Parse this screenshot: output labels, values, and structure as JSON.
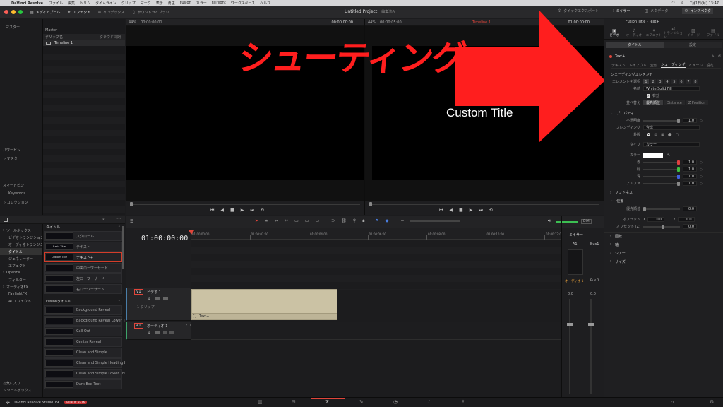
{
  "menubar": {
    "app": "DaVinci Resolve",
    "items": [
      "ファイル",
      "編集",
      "トリム",
      "タイムライン",
      "クリップ",
      "マーク",
      "表示",
      "再生",
      "Fusion",
      "カラー",
      "Fairlight",
      "ワークスペース",
      "ヘルプ"
    ],
    "clock": "7月1日(月) 13:47"
  },
  "titlebar": {
    "media_pool": "メディアプール",
    "effects": "エフェクト",
    "index": "インデックス",
    "sound_library": "サウンドライブラリ",
    "project": "Untitled Project",
    "edited": "編集済み",
    "quick_export": "クイックエクスポート",
    "mixer": "ミキサー",
    "metadata": "メタデータ",
    "inspector": "インスペクタ"
  },
  "media": {
    "master": "マスター",
    "master2": "Master",
    "col_clip": "クリップ名",
    "col_cloud": "クラウド同期",
    "timeline": "Timeline 1",
    "power_bins": "パワービン",
    "power_master": "マスター",
    "smart_bins": "スマートビン",
    "keywords": "Keywords",
    "collections": "コレクション"
  },
  "source_viewer": {
    "zoom": "44%",
    "timecode": "00:00:00:01",
    "tc_right": "00:00:00:00"
  },
  "timeline_viewer": {
    "zoom": "44%",
    "timecode": "00:00:05:00",
    "name": "Timeline 1",
    "tc_right": "01:00:00:00"
  },
  "overlay": {
    "heading": "シューティング",
    "custom_title": "Custom Title"
  },
  "effects": {
    "tree": [
      {
        "label": "ツールボックス",
        "indent": 0
      },
      {
        "label": "ビデオトランジション",
        "indent": 1
      },
      {
        "label": "オーディオトランジション",
        "indent": 1
      },
      {
        "label": "タイトル",
        "indent": 1,
        "selected": true
      },
      {
        "label": "ジェネレーター",
        "indent": 1
      },
      {
        "label": "エフェクト",
        "indent": 1
      },
      {
        "label": "OpenFX",
        "indent": 0
      },
      {
        "label": "フィルター",
        "indent": 1
      },
      {
        "label": "オーディオFX",
        "indent": 0
      },
      {
        "label": "FairlightFX",
        "indent": 1
      },
      {
        "label": "AUエフェクト",
        "indent": 1
      }
    ],
    "fav": "お気に入り",
    "fav_toolbox": "ツールボックス",
    "titles_header": "タイトル",
    "titles": [
      {
        "label": "スクロール",
        "thumb": ""
      },
      {
        "label": "テキスト",
        "thumb": "Basic Title"
      },
      {
        "label": "テキスト+",
        "thumb": "Custom Title",
        "selected": true
      },
      {
        "label": "中央ローワーサード",
        "thumb": ""
      },
      {
        "label": "左ローワーサード",
        "thumb": ""
      },
      {
        "label": "右ローワーサード",
        "thumb": ""
      }
    ],
    "fusion_header": "Fusionタイトル",
    "fusion": [
      "Background Reveal",
      "Background Reveal Lower Third",
      "Call Out",
      "Center Reveal",
      "Clean and Simple",
      "Clean and Simple Heading Low...",
      "Clean and Simple Lower Third",
      "Dark Box Text"
    ]
  },
  "timeline": {
    "timecode": "01:00:00:00",
    "ruler": [
      "01:00:00:00",
      "01:00:02:00",
      "01:00:04:00",
      "01:00:06:00",
      "01:00:08:00",
      "01:00:10:00",
      "01:00:12:00"
    ],
    "v1": "V1",
    "v1_name": "ビデオ 1",
    "v1_clips": "1 クリップ",
    "a1": "A1",
    "a1_name": "オーディオ 1",
    "a1_ch": "2.0",
    "clip": "Text+",
    "dim": "DIM"
  },
  "mixer": {
    "title": "ミキサー",
    "a1": "A1",
    "bus1": "Bus1",
    "audio1": "オーディオ 1",
    "bus1b": "Bus 1",
    "db1": "0.0",
    "db2": "0.0"
  },
  "inspector": {
    "title": "Fusion Title - Text+",
    "tabs": [
      "ビデオ",
      "オーディオ",
      "エフェクト",
      "トランジション",
      "イメージ",
      "ファイル"
    ],
    "sub_title": "タイトル",
    "sub_settings": "設定",
    "node": "Text+",
    "subtabs": [
      "テキスト",
      "レイアウト",
      "変形",
      "シェーディング",
      "イメージ",
      "設定"
    ],
    "shading_el": "シェーディングエレメント",
    "select_el": "エレメントを選択",
    "el_nums": [
      "1",
      "2",
      "3",
      "4",
      "5",
      "6",
      "7",
      "8"
    ],
    "name_label": "名前",
    "name_value": "White Solid Fill",
    "enabled": "有効",
    "sort_label": "並べ替え",
    "sort_opts": [
      "優先順位",
      "Distance",
      "Z Position"
    ],
    "props": "プロパティ",
    "opacity_label": "不透明度",
    "opacity": "1.0",
    "blend_label": "ブレンディング",
    "blend_value": "合成",
    "appearance_label": "外観",
    "type_label": "タイプ",
    "type_value": "カラー",
    "color_label": "カラー",
    "red_label": "赤",
    "green_label": "緑",
    "blue_label": "青",
    "alpha_label": "アルファ",
    "red": "1.0",
    "green": "1.0",
    "blue": "1.0",
    "alpha": "1.0",
    "softness": "ソフトネス",
    "position": "位置",
    "priority_label": "優先順位",
    "priority": "0.0",
    "offset_label": "オフセット",
    "off_x_l": "X",
    "off_x": "0.0",
    "off_y_l": "Y",
    "off_y": "0.0",
    "offset_z_label": "オフセット (Z)",
    "offset_z": "0.0",
    "rotation": "回転",
    "axis": "軸",
    "shear": "シアー",
    "size": "サイズ"
  },
  "status": {
    "product": "DaVinci Resolve Studio 19",
    "beta": "PUBLIC BETA"
  },
  "colors": {
    "accent_red": "#ff1e1e",
    "clip": "#cbc2a4",
    "playhead": "#e0453a"
  }
}
